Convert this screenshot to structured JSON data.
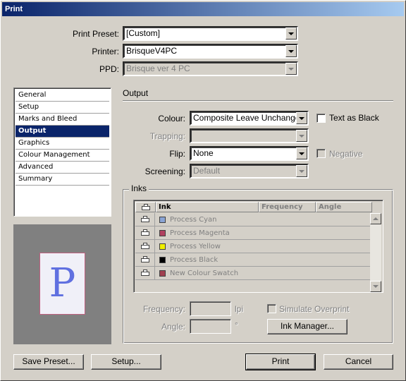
{
  "window": {
    "title": "Print"
  },
  "top": {
    "preset_label": "Print Preset:",
    "preset_value": "[Custom]",
    "printer_label": "Printer:",
    "printer_value": "BrisqueV4PC",
    "ppd_label": "PPD:",
    "ppd_value": "Brisque ver 4 PC"
  },
  "sidebar": {
    "items": [
      {
        "label": "General"
      },
      {
        "label": "Setup"
      },
      {
        "label": "Marks and Bleed"
      },
      {
        "label": "Output"
      },
      {
        "label": "Graphics"
      },
      {
        "label": "Colour Management"
      },
      {
        "label": "Advanced"
      },
      {
        "label": "Summary"
      }
    ],
    "selected": "Output"
  },
  "preview": {
    "letter": "P"
  },
  "output": {
    "section_title": "Output",
    "colour_label": "Colour:",
    "colour_value": "Composite Leave Unchanged",
    "text_as_black_label": "Text as Black",
    "trapping_label": "Trapping:",
    "trapping_value": "",
    "flip_label": "Flip:",
    "flip_value": "None",
    "negative_label": "Negative",
    "screening_label": "Screening:",
    "screening_value": "Default"
  },
  "inks": {
    "group_label": "Inks",
    "headers": {
      "ink": "Ink",
      "frequency": "Frequency",
      "angle": "Angle"
    },
    "rows": [
      {
        "name": "Process Cyan",
        "color": "#8aa4d4"
      },
      {
        "name": "Process Magenta",
        "color": "#b04060"
      },
      {
        "name": "Process Yellow",
        "color": "#f0f000"
      },
      {
        "name": "Process Black",
        "color": "#000000"
      },
      {
        "name": "New Colour Swatch",
        "color": "#a04050"
      }
    ],
    "frequency_label": "Frequency:",
    "frequency_unit": "lpi",
    "angle_label": "Angle:",
    "angle_unit": "°",
    "simulate_overprint_label": "Simulate Overprint",
    "ink_manager_label": "Ink Manager..."
  },
  "buttons": {
    "save_preset": "Save Preset...",
    "setup": "Setup...",
    "print": "Print",
    "cancel": "Cancel"
  }
}
